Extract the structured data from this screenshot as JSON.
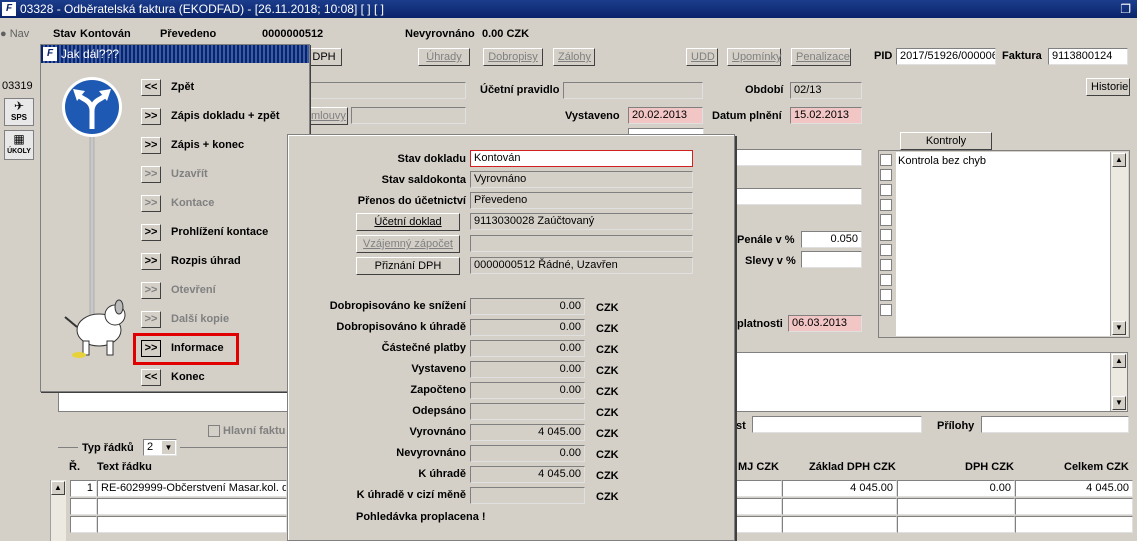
{
  "window": {
    "title": "03328 - Odběratelská faktura (EKODFAD) - [26.11.2018; 10:08] [ ] [ ]"
  },
  "header": {
    "nav_label": "Nav",
    "stav_label": "Stav",
    "stav_value": "Kontován",
    "prevedeno": "Převedeno",
    "cislo": "0000000512",
    "nevyrovnano_label": "Nevyrovnáno",
    "nevyrovnano_value": "0.00 CZK",
    "side_number": "03319",
    "sps_label": "SPS",
    "ukoly_label": "ÚKOLY"
  },
  "toolbar": {
    "dph": "DPH",
    "uhrady": "Úhrady",
    "dobropisy": "Dobropisy",
    "zalohy": "Zálohy",
    "udd": "UDD",
    "upominky": "Upomínky",
    "penalizace": "Penalizace",
    "pid_label": "PID",
    "pid_value": "2017/51926/000006",
    "faktura_label": "Faktura",
    "faktura_value": "9113800124"
  },
  "form": {
    "ucetni_pravidlo": "Účetní pravidlo",
    "obdobi_label": "Období",
    "obdobi_value": "02/13",
    "historie": "Historie",
    "smlouvy": "mlouvy",
    "vystaveno_label": "Vystaveno",
    "vystaveno_value": "20.02.2013",
    "datum_plneni_label": "Datum plnění",
    "datum_plneni_value": "15.02.2013",
    "kontroly_tab": "Kontroly",
    "kontrola_item": "Kontrola bez chyb",
    "penale_label": "Penále v %",
    "penale_value": "0.050",
    "slevy_label": "Slevy v %",
    "splatnosti_label": "platnosti",
    "splatnosti_value": "06.03.2013",
    "hlavni_faktura": "Hlavní faktu",
    "st_label": "st",
    "prilohy_label": "Přílohy"
  },
  "grid": {
    "typ_radku_label": "Typ řádků",
    "typ_radku_value": "2",
    "columns": {
      "r": "Ř.",
      "text": "Text řádku",
      "mj": "MJ CZK",
      "zaklad": "Základ DPH CZK",
      "dph": "DPH CZK",
      "celkem": "Celkem CZK"
    },
    "rows": [
      {
        "r": "1",
        "text": "RE-6029999-Občerstvení Masar.kol. dr",
        "zaklad": "4 045.00",
        "dph": "0.00",
        "celkem": "4 045.00"
      }
    ]
  },
  "jak_dal": {
    "title": "Jak dál???",
    "items": [
      {
        "btn": "<<",
        "label": "Zpět"
      },
      {
        "btn": ">>",
        "label": "Zápis dokladu + zpět"
      },
      {
        "btn": ">>",
        "label": "Zápis + konec"
      },
      {
        "btn": ">>",
        "label": "Uzavřít"
      },
      {
        "btn": ">>",
        "label": "Kontace"
      },
      {
        "btn": ">>",
        "label": "Prohlížení kontace"
      },
      {
        "btn": ">>",
        "label": "Rozpis úhrad"
      },
      {
        "btn": ">>",
        "label": "Otevření"
      },
      {
        "btn": ">>",
        "label": "Další kopie"
      },
      {
        "btn": ">>",
        "label": "Informace"
      },
      {
        "btn": "<<",
        "label": "Konec"
      }
    ]
  },
  "info": {
    "stav_dokladu_label": "Stav dokladu",
    "stav_dokladu_value": "Kontován",
    "stav_saldokonta_label": "Stav saldokonta",
    "stav_saldokonta_value": "Vyrovnáno",
    "prenos_label": "Přenos do účetnictví",
    "prenos_value": "Převedeno",
    "ucetni_doklad_btn": "Účetní doklad",
    "ucetni_doklad_value": "9113030028 Zaúčtovaný",
    "vzajemny_btn": "Vzájemný zápočet",
    "priznani_btn": "Přiznání DPH",
    "priznani_value": "0000000512 Řádné, Uzavřen",
    "currency": "CZK",
    "amounts": [
      {
        "label": "Dobropisováno ke snížení",
        "value": "0.00"
      },
      {
        "label": "Dobropisováno k úhradě",
        "value": "0.00"
      },
      {
        "label": "Částečné platby",
        "value": "0.00"
      },
      {
        "label": "Vystaveno",
        "value": "0.00"
      },
      {
        "label": "Započteno",
        "value": "0.00"
      },
      {
        "label": "Odepsáno",
        "value": ""
      },
      {
        "label": "Vyrovnáno",
        "value": "4 045.00"
      },
      {
        "label": "Nevyrovnáno",
        "value": "0.00"
      },
      {
        "label": "K úhradě",
        "value": "4 045.00"
      },
      {
        "label": "K úhradě v cizí měně",
        "value": ""
      }
    ],
    "footer": "Pohledávka proplacena !"
  }
}
